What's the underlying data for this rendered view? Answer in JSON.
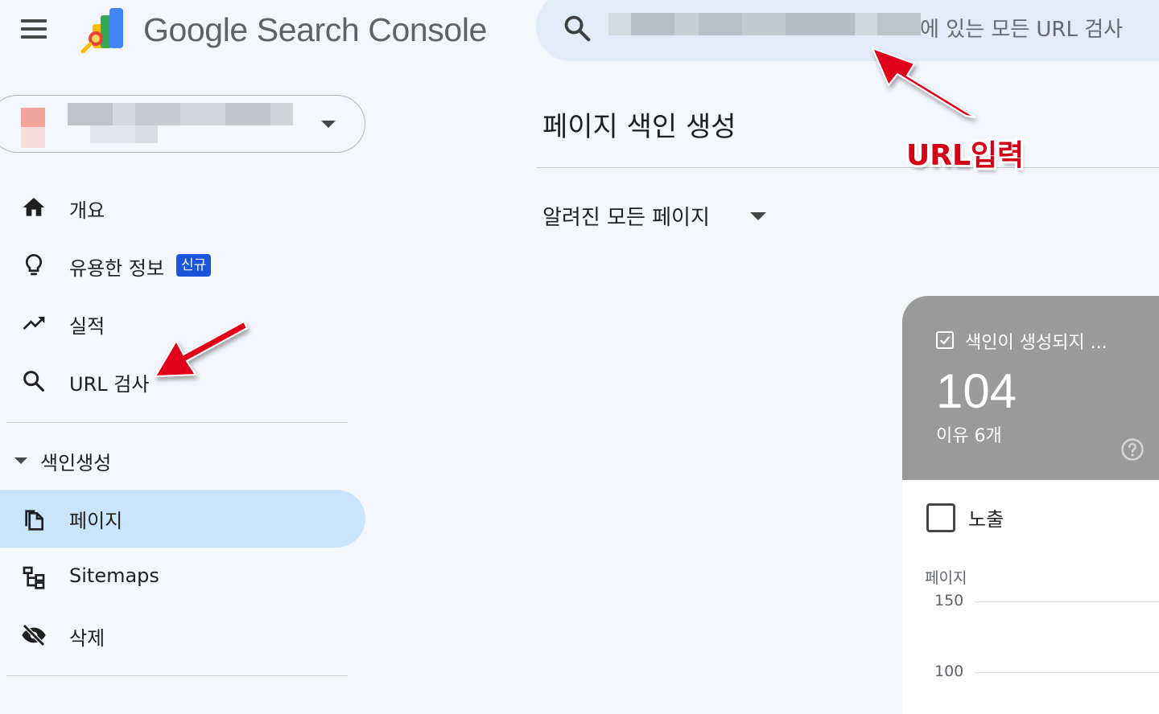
{
  "header": {
    "brand": "Google Search Console",
    "search": {
      "placeholder_suffix": "에 있는 모든 URL 검사"
    }
  },
  "property": {
    "name_hidden": true
  },
  "sidebar": {
    "items": [
      {
        "id": "overview",
        "label": "개요",
        "icon": "home-icon"
      },
      {
        "id": "insights",
        "label": "유용한 정보",
        "icon": "lightbulb-icon",
        "badge": "신규"
      },
      {
        "id": "performance",
        "label": "실적",
        "icon": "trending-up-icon"
      },
      {
        "id": "url-inspection",
        "label": "URL 검사",
        "icon": "search-icon"
      }
    ],
    "section": {
      "label": "색인생성"
    },
    "index_items": [
      {
        "id": "pages",
        "label": "페이지",
        "icon": "copy-pages-icon",
        "active": true
      },
      {
        "id": "sitemaps",
        "label": "Sitemaps",
        "icon": "sitemap-icon"
      },
      {
        "id": "removals",
        "label": "삭제",
        "icon": "eye-off-icon"
      }
    ]
  },
  "main": {
    "title": "페이지 색인 생성",
    "filter": {
      "selected": "알려진 모든 페이지"
    },
    "card": {
      "title": "색인이 생성되지 ...",
      "count": "104",
      "subtitle": "이유 6개",
      "checked": true
    },
    "impressions": {
      "label": "노출",
      "checked": false
    },
    "chart": {
      "ylabel": "페이지",
      "ticks": [
        "150",
        "100"
      ]
    }
  },
  "annotation": {
    "text": "URL입력",
    "color": "#d40016"
  },
  "colors": {
    "background": "#f3f6fb",
    "search_bg": "#e3ebf8",
    "active_nav": "#c9e4fb",
    "badge": "#1a56db",
    "card_header": "#9a9a9a"
  }
}
